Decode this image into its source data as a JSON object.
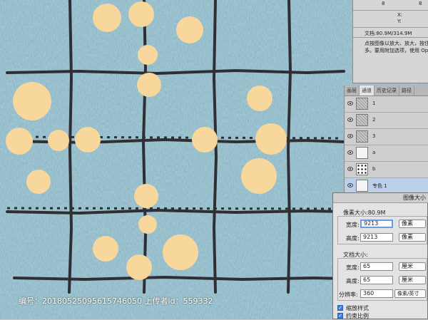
{
  "info_panel": {
    "row1_value": "8",
    "row1b_value": "8",
    "x_label": "X:",
    "y_label": "Y:",
    "doc_size": "文档:80.9M/314.9M",
    "hint_line1": "点按图像以放大、放大，按住拖移以",
    "hint_line2": "多。要用附加选项，使用 Opt 和"
  },
  "channels_panel": {
    "tabs": [
      "画层",
      "通道",
      "历史记录",
      "路径"
    ],
    "active_tab": "通道",
    "channels": [
      {
        "name": "1",
        "thumb": "gray"
      },
      {
        "name": "2",
        "thumb": "gray"
      },
      {
        "name": "3",
        "thumb": "gray"
      },
      {
        "name": "a",
        "thumb": "white"
      },
      {
        "name": "b",
        "thumb": "dots"
      },
      {
        "name": "专色 1",
        "thumb": "white"
      }
    ]
  },
  "image_size_dialog": {
    "title": "图像大小",
    "pixel_size": "像素大小:80.9M",
    "width_label": "宽度:",
    "width_value": "9213",
    "width_unit": "像素",
    "height_label": "高度:",
    "height_value": "9213",
    "height_unit": "像素",
    "doc_size_label": "文档大小:",
    "doc_width_label": "宽度:",
    "doc_width_value": "65",
    "doc_width_unit": "厘米",
    "doc_height_label": "高度:",
    "doc_height_value": "65",
    "doc_height_unit": "厘米",
    "resolution_label": "分辨率:",
    "resolution_value": "360",
    "resolution_unit": "像素/英寸",
    "scale_styles_label": "缩放样式",
    "constrain_label": "约束比例"
  },
  "footer": {
    "text": "编号：20180525095615746050 上传者id：559332"
  },
  "colors": {
    "fabric": "#7fb0c0",
    "dot": "#f8d79c",
    "grid_line": "#2f2f33"
  }
}
